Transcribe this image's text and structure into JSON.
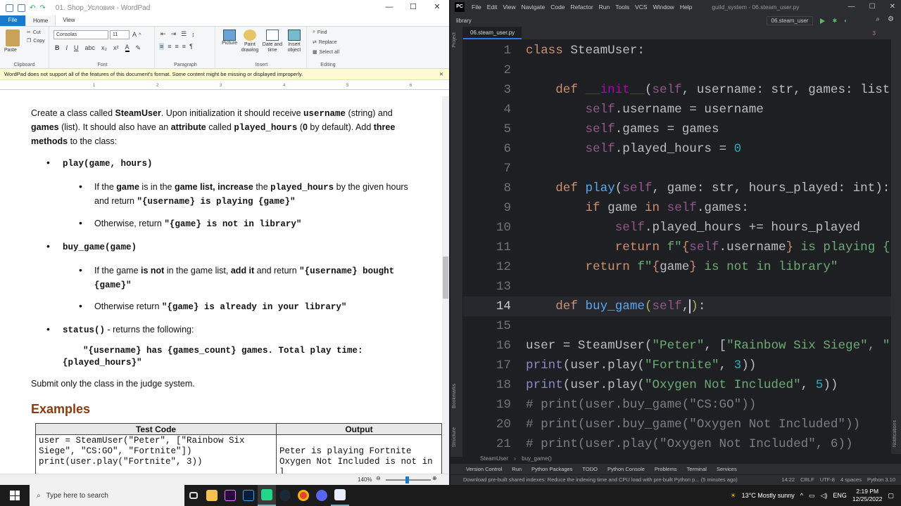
{
  "wordpad": {
    "title": "01. Shop_Условия - WordPad",
    "tabs": {
      "file": "File",
      "home": "Home",
      "view": "View"
    },
    "clipboard": {
      "paste": "Paste",
      "cut": "Cut",
      "copy": "Copy",
      "label": "Clipboard"
    },
    "font": {
      "family": "Consolas",
      "size": "11",
      "label": "Font"
    },
    "paragraph_label": "Paragraph",
    "insert": {
      "picture": "Picture",
      "paint": "Paint drawing",
      "datetime": "Date and time",
      "object": "Insert object",
      "label": "Insert"
    },
    "editing": {
      "find": "Find",
      "replace": "Replace",
      "select_all": "Select all",
      "label": "Editing"
    },
    "infobar": "WordPad does not support all of the features of this document's format. Some content might be missing or displayed improperly.",
    "ruler_ticks": [
      "1",
      "2",
      "3",
      "4",
      "5",
      "6"
    ],
    "doc": {
      "intro_1": "Create a class called ",
      "intro_class": "SteamUser",
      "intro_2": ". Upon initialization it should receive ",
      "intro_username": "username",
      "intro_3": " (string) and ",
      "intro_games": "games",
      "intro_4": " (list).  It should also have an ",
      "intro_attr": "attribute",
      "intro_5": " called ",
      "intro_played": "played_hours",
      "intro_6": " (",
      "intro_zero": "0",
      "intro_7": " by default).  Add ",
      "intro_three": "three",
      "intro_methods": "methods",
      "intro_8": " to the class:",
      "m1": "play(game, hours)",
      "m1_a1": "If the ",
      "m1_a2": "game",
      "m1_a3": " is in the ",
      "m1_a4": "game list, increase",
      "m1_a5": " the ",
      "m1_a6": "played_hours",
      "m1_a7": " by the given hours and return ",
      "m1_a8": "\"{username} is playing {game}\"",
      "m1_b1": "Otherwise,  return ",
      "m1_b2": "\"{game} is not in library\"",
      "m2": "buy_game(game)",
      "m2_a1": "If the game ",
      "m2_a2": "is not",
      "m2_a3": " in the game list, ",
      "m2_a4": "add it",
      "m2_a5": " and return ",
      "m2_a6": "\"{username} bought {game}\"",
      "m2_b1": "Otherwise  return ",
      "m2_b2": "\"{game} is already in your library\"",
      "m3": "status()",
      "m3_desc": " - returns the following:",
      "m3_ret_1": "\"{username} has {games_count} games. Total play time:",
      "m3_ret_2": "{played_hours}\"",
      "submit": "Submit only the class in the judge system.",
      "examples": "Examples"
    },
    "table": {
      "headers": [
        "Test Code",
        "Output"
      ],
      "code_lines": [
        "user = SteamUser(\"Peter\", [\"Rainbow Six",
        "Siege\", \"CS:GO\", \"Fortnite\"])",
        "print(user.play(\"Fortnite\", 3))"
      ],
      "output_lines": [
        "",
        "Peter is playing Fortnite",
        "Oxygen Not Included is not in l"
      ]
    },
    "zoom": "140%"
  },
  "pycharm": {
    "menu": [
      "File",
      "Edit",
      "View",
      "Navigate",
      "Code",
      "Refactor",
      "Run",
      "Tools",
      "VCS",
      "Window",
      "Help"
    ],
    "project_title": "guild_system - 06.steam_user.py",
    "breadcrumb_root": "library",
    "run_config": "06.steam_user",
    "file_tab": "06.steam_user.py",
    "warnings": "3",
    "side_project": "Project",
    "side_bookmarks": "Bookmarks",
    "side_structure": "Structure",
    "side_right": "Notifications",
    "lines": [
      "1",
      "2",
      "3",
      "4",
      "5",
      "6",
      "7",
      "8",
      "9",
      "10",
      "11",
      "12",
      "13",
      "14",
      "15",
      "16",
      "17",
      "18",
      "19",
      "20",
      "21"
    ],
    "breadcrumb": [
      "SteamUser",
      "buy_game()"
    ],
    "tools": [
      "Version Control",
      "Run",
      "Python Packages",
      "TODO",
      "Python Console",
      "Problems",
      "Terminal",
      "Services"
    ],
    "status_msg": "Download pre-built shared indexes: Reduce the indexing time and CPU load with pre-built Python p... (5 minutes ago)",
    "status_right": [
      "14:22",
      "CRLF",
      "UTF-8",
      "4 spaces",
      "Python 3.10"
    ]
  },
  "taskbar": {
    "search": "Type here to search",
    "weather": "13°C  Mostly sunny",
    "lang": "ENG",
    "time": "2:19 PM",
    "date": "12/25/2022"
  }
}
